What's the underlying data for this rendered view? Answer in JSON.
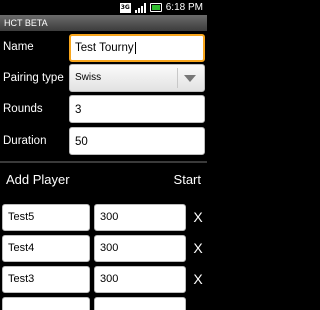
{
  "status_bar": {
    "sim_label": "3G",
    "time": "6:18 PM"
  },
  "app": {
    "title": "HCT BETA"
  },
  "form": {
    "name_label": "Name",
    "name_value": "Test Tourny",
    "pairing_label": "Pairing type",
    "pairing_value": "Swiss",
    "rounds_label": "Rounds",
    "rounds_value": "3",
    "duration_label": "Duration",
    "duration_value": "50"
  },
  "players_header": {
    "add_player_label": "Add Player",
    "start_label": "Start"
  },
  "players": [
    {
      "name": "Test5",
      "rating": "300",
      "remove": "X"
    },
    {
      "name": "Test4",
      "rating": "300",
      "remove": "X"
    },
    {
      "name": "Test3",
      "rating": "300",
      "remove": "X"
    }
  ],
  "colors": {
    "focus": "#f7a51c",
    "battery": "#2fbd2f"
  }
}
